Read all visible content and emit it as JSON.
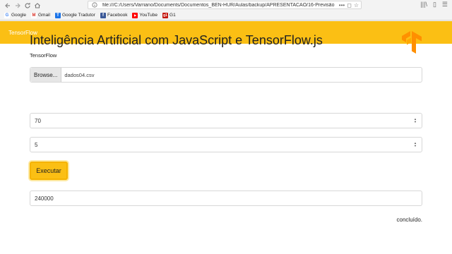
{
  "browser": {
    "url": "file:///C:/Users/Varriano/Documents/Documentos_BEN-HUR/Aulas/backup/APRESENTACAO/16-Previsão",
    "bookmarks": [
      {
        "label": "Google",
        "icon": "google-icon",
        "color": "#4285f4",
        "glyph": "G"
      },
      {
        "label": "Gmail",
        "icon": "gmail-icon",
        "color": "#d93025",
        "glyph": "M"
      },
      {
        "label": "Google Tradutor",
        "icon": "translate-icon",
        "color": "#1a73e8",
        "glyph": "T"
      },
      {
        "label": "Facebook",
        "icon": "facebook-icon",
        "color": "#3b5998",
        "glyph": "f"
      },
      {
        "label": "YouTube",
        "icon": "youtube-icon",
        "color": "#ff0000",
        "glyph": "▶"
      },
      {
        "label": "G1",
        "icon": "g1-icon",
        "color": "#c4170c",
        "glyph": "g1"
      }
    ]
  },
  "app": {
    "brand": "TensorFlow",
    "title": "Inteligência Artificial com JavaScript e TensorFlow.js",
    "subtitle": "TensorFlow",
    "browse_label": "Browse...",
    "file_name": "dados04.csv",
    "input1_value": "70",
    "input2_value": "5",
    "execute_label": "Executar",
    "output_value": "240000",
    "status": "concluído.",
    "accent": "#fbbf14"
  }
}
